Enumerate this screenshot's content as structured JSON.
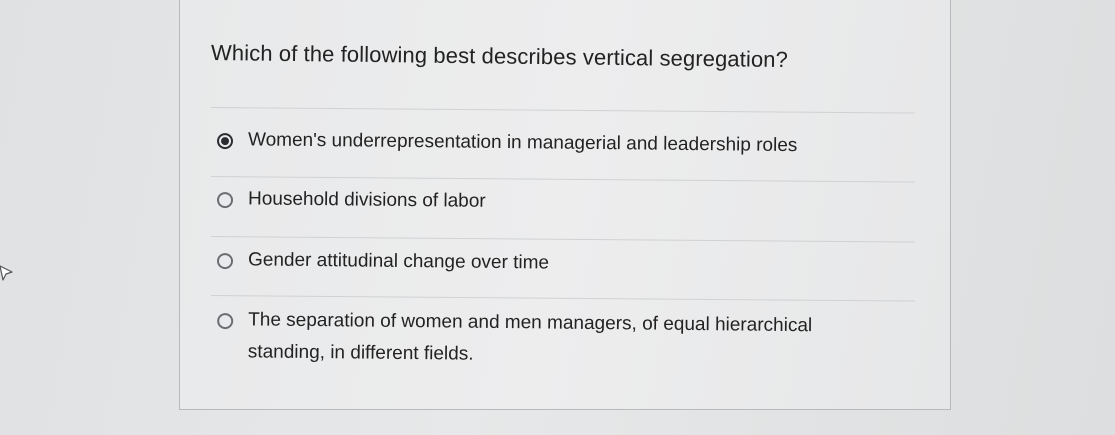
{
  "question": {
    "text": "Which of the following best describes vertical segregation?"
  },
  "options": [
    {
      "label": "Women's underrepresentation in managerial and leadership roles",
      "selected": true
    },
    {
      "label": "Household divisions of labor",
      "selected": false
    },
    {
      "label": "Gender attitudinal change over time",
      "selected": false
    },
    {
      "label": "The separation of women and men managers, of equal hierarchical standing, in different fields.",
      "selected": false
    }
  ],
  "icons": {
    "cursor": "mouse-pointer-icon",
    "radio": "radio-button-icon"
  },
  "colors": {
    "text": "#222222",
    "radio_border": "#6a6d71",
    "radio_selected": "#2a2c2f",
    "background": "#e2e3e4"
  }
}
